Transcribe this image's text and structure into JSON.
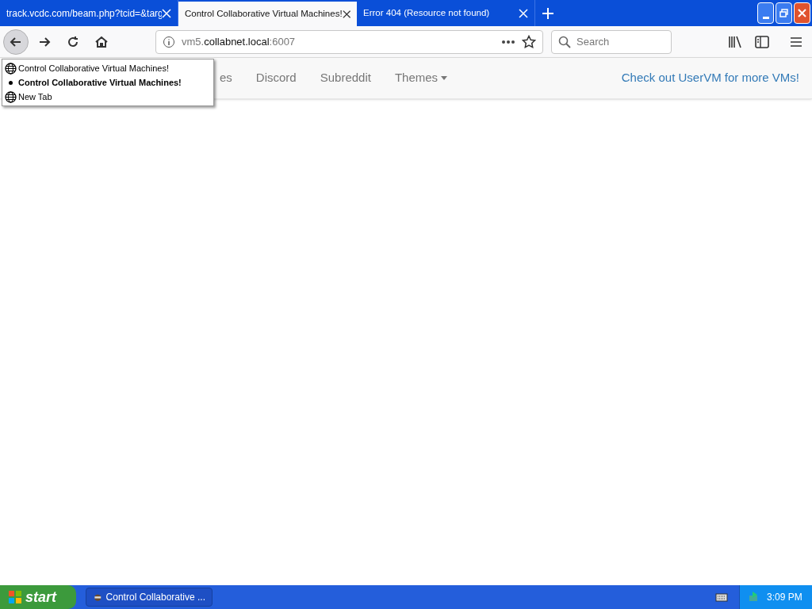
{
  "tabs": [
    {
      "title": "track.vcdc.com/beam.php?tcid=&targ",
      "selected": false
    },
    {
      "title": "Control Collaborative Virtual Machines!",
      "selected": true
    },
    {
      "title": "Error 404 (Resource not found)",
      "selected": false
    }
  ],
  "toolbar": {
    "url_host": "vm5.",
    "url_domain": "collabnet.local",
    "url_port": ":6007",
    "search_placeholder": "Search"
  },
  "history_menu": [
    {
      "label": "Control Collaborative Virtual Machines!",
      "current": false
    },
    {
      "label": "Control Collaborative Virtual Machines!",
      "current": true
    },
    {
      "label": "New Tab",
      "current": false
    }
  ],
  "navbar": {
    "items": [
      {
        "label": "es",
        "dropdown": false
      },
      {
        "label": "Discord",
        "dropdown": false
      },
      {
        "label": "Subreddit",
        "dropdown": false
      },
      {
        "label": "Themes",
        "dropdown": true
      }
    ],
    "right_link": "Check out UserVM for more VMs!"
  },
  "taskbar": {
    "start": "start",
    "tasks": [
      "Control Collaborative ..."
    ],
    "clock": "3:09 PM"
  }
}
